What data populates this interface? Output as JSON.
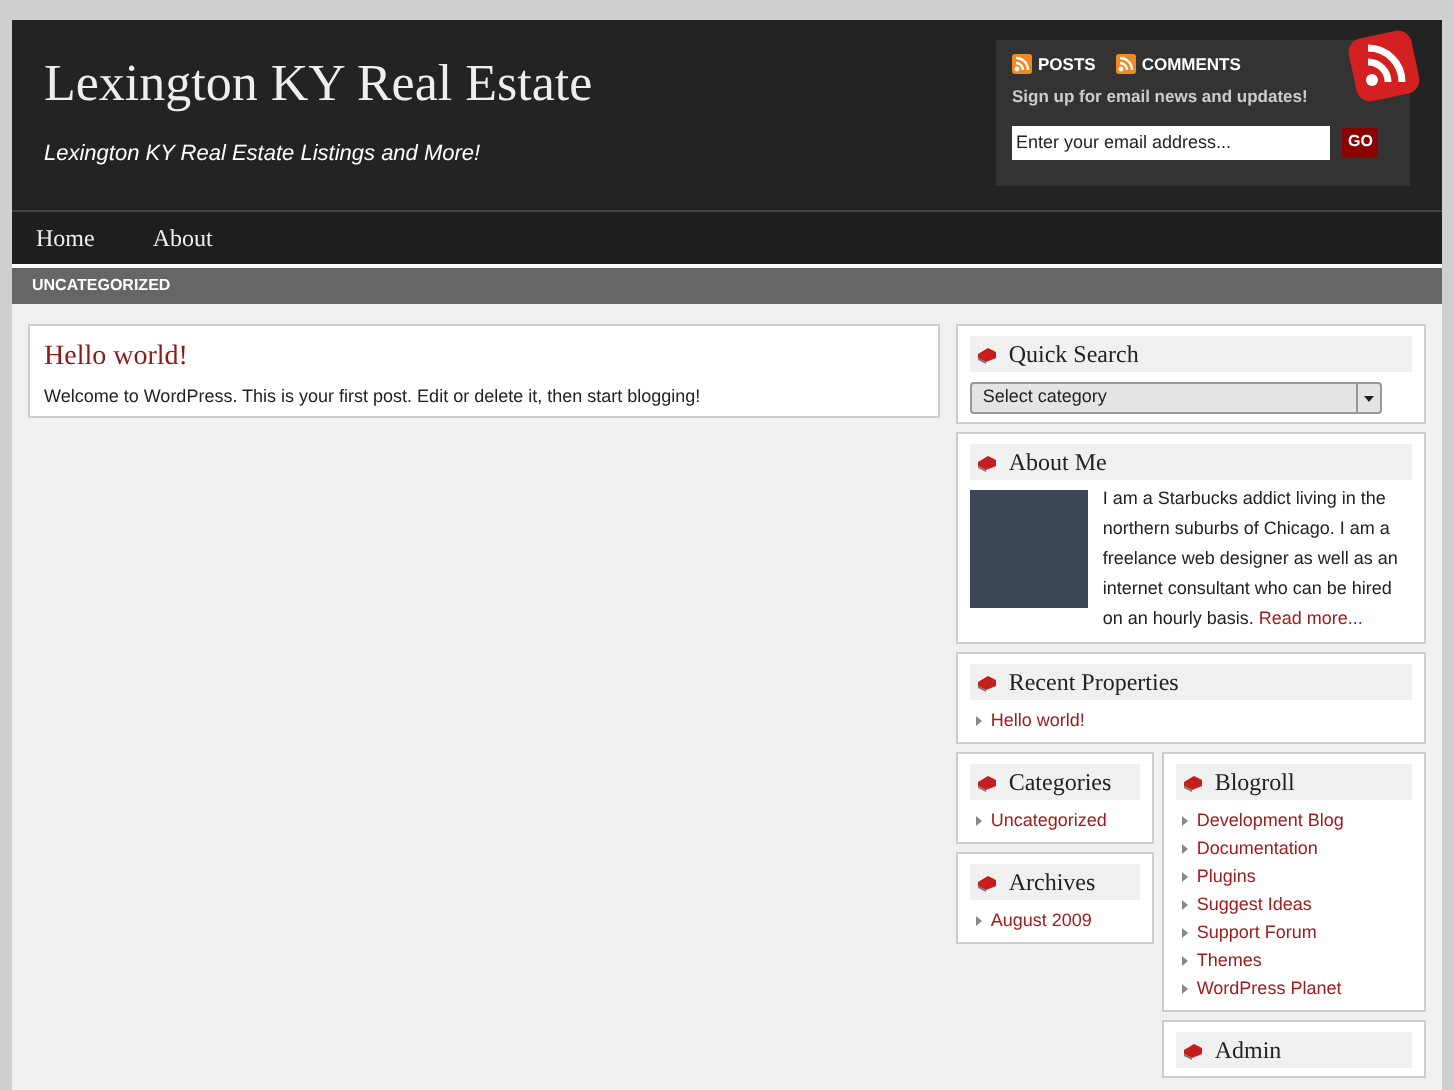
{
  "header": {
    "title": "Lexington KY Real Estate",
    "tagline": "Lexington KY Real Estate Listings and More!",
    "feeds": [
      "POSTS",
      "COMMENTS"
    ],
    "signup": "Sign up for email news and updates!",
    "email_placeholder": "Enter your email address...",
    "go_button": "GO"
  },
  "nav": [
    {
      "label": "Home"
    },
    {
      "label": "About"
    }
  ],
  "category_bar": "UNCATEGORIZED",
  "post": {
    "title": "Hello world!",
    "body": "Welcome to WordPress. This is your first post. Edit or delete it, then start blogging!"
  },
  "quick_search": {
    "title": "Quick Search",
    "select": "Select category"
  },
  "about": {
    "title": "About Me",
    "text": "I am a Starbucks addict living in the northern suburbs of Chicago. I am a freelance web designer as well as an internet consultant who can be hired on an hourly basis.",
    "link": "Read more..."
  },
  "recent": {
    "title": "Recent Properties",
    "items": [
      "Hello world!"
    ]
  },
  "categories": {
    "title": "Categories",
    "items": [
      "Uncategorized"
    ]
  },
  "archives": {
    "title": "Archives",
    "items": [
      "August 2009"
    ]
  },
  "blogroll": {
    "title": "Blogroll",
    "items": [
      "Development Blog",
      "Documentation",
      "Plugins",
      "Suggest Ideas",
      "Support Forum",
      "Themes",
      "WordPress Planet"
    ]
  },
  "admin": {
    "title": "Admin"
  }
}
